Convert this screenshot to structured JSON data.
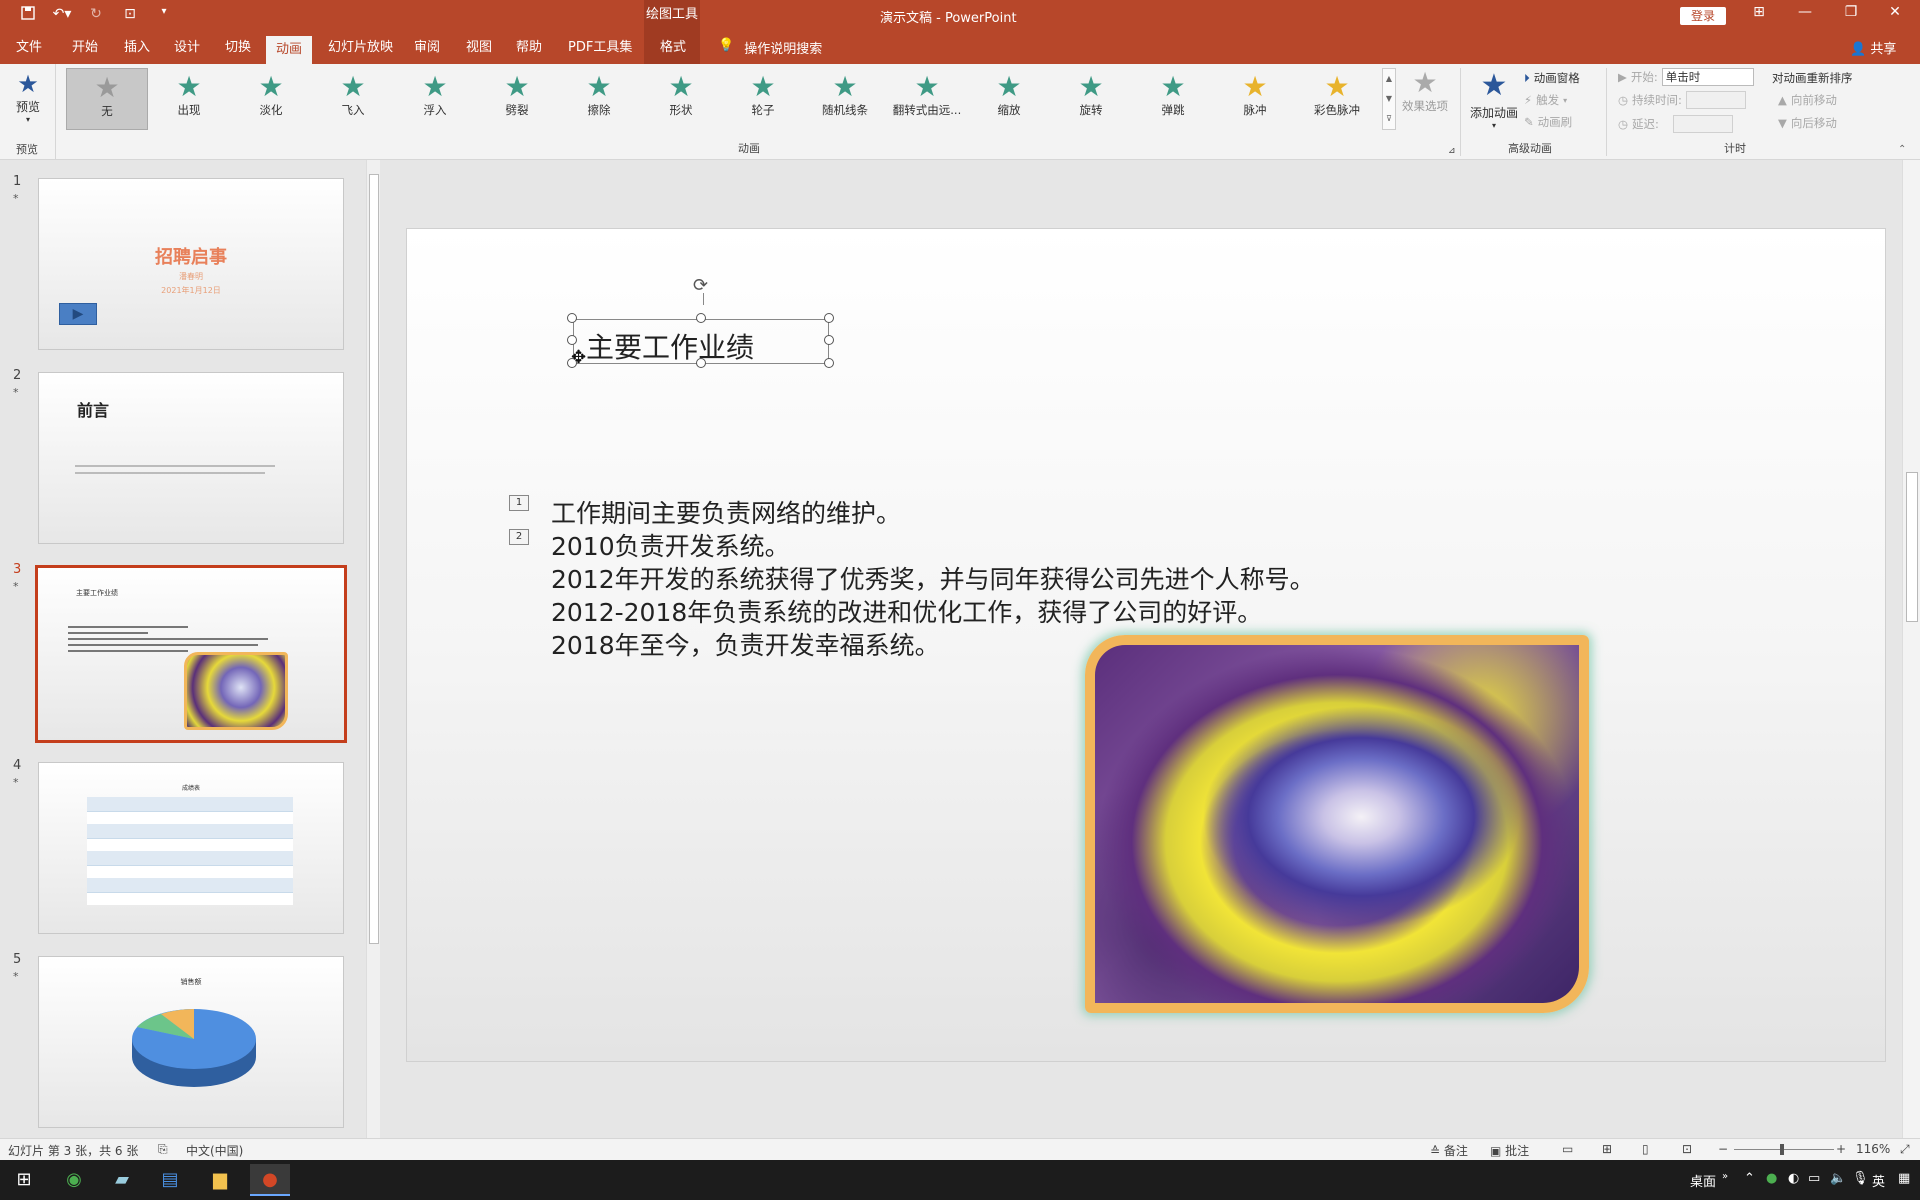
{
  "titlebar": {
    "context_label": "绘图工具",
    "document_title": "演示文稿  -  PowerPoint",
    "login_label": "登录"
  },
  "tabs": {
    "file": "文件",
    "home": "开始",
    "insert": "插入",
    "design": "设计",
    "transitions": "切换",
    "animations": "动画",
    "slideshow": "幻灯片放映",
    "review": "审阅",
    "view": "视图",
    "help": "帮助",
    "pdf": "PDF工具集",
    "format": "格式",
    "tellme": "操作说明搜索",
    "share": "共享"
  },
  "ribbon": {
    "preview_label": "预览",
    "preview_group": "预览",
    "animation_group": "动画",
    "effects": [
      "无",
      "出现",
      "淡化",
      "飞入",
      "浮入",
      "劈裂",
      "擦除",
      "形状",
      "轮子",
      "随机线条",
      "翻转式由远...",
      "缩放",
      "旋转",
      "弹跳",
      "脉冲",
      "彩色脉冲"
    ],
    "effect_options": "效果选项",
    "add_animation": "添加动画",
    "animation_pane": "动画窗格",
    "trigger": "触发",
    "animation_painter": "动画刷",
    "advanced_group": "高级动画",
    "start_label": "开始:",
    "start_value": "单击时",
    "duration_label": "持续时间:",
    "delay_label": "延迟:",
    "timing_group": "计时",
    "reorder_title": "对动画重新排序",
    "move_earlier": "向前移动",
    "move_later": "向后移动"
  },
  "thumbnails": {
    "slide1": {
      "num": "1",
      "title": "招聘启事",
      "subtitle": "潘春明",
      "date": "2021年1月12日"
    },
    "slide2": {
      "num": "2",
      "title": "前言"
    },
    "slide3": {
      "num": "3",
      "title": "主要工作业绩"
    },
    "slide4": {
      "num": "4",
      "title": "成绩表"
    },
    "slide5": {
      "num": "5",
      "title": "销售额"
    }
  },
  "slide": {
    "title": "主要工作业绩",
    "anim_tags": [
      "1",
      "2"
    ],
    "body_lines": [
      "工作期间主要负责网络的维护。",
      "2010负责开发系统。",
      "2012年开发的系统获得了优秀奖，并与同年获得公司先进个人称号。",
      "2012-2018年负责系统的改进和优化工作，获得了公司的好评。",
      "2018年至今，负责开发幸福系统。"
    ]
  },
  "statusbar": {
    "slide_info": "幻灯片 第 3 张，共 6 张",
    "language": "中文(中国)",
    "notes": "备注",
    "comments": "批注",
    "zoom": "116%"
  },
  "taskbar": {
    "desktop": "桌面",
    "ime": "英"
  },
  "colors": {
    "accent": "#b7472a",
    "selection": "#c43e1c",
    "effect_green": "#3f9a85",
    "photo_frame": "#f2b65a"
  }
}
